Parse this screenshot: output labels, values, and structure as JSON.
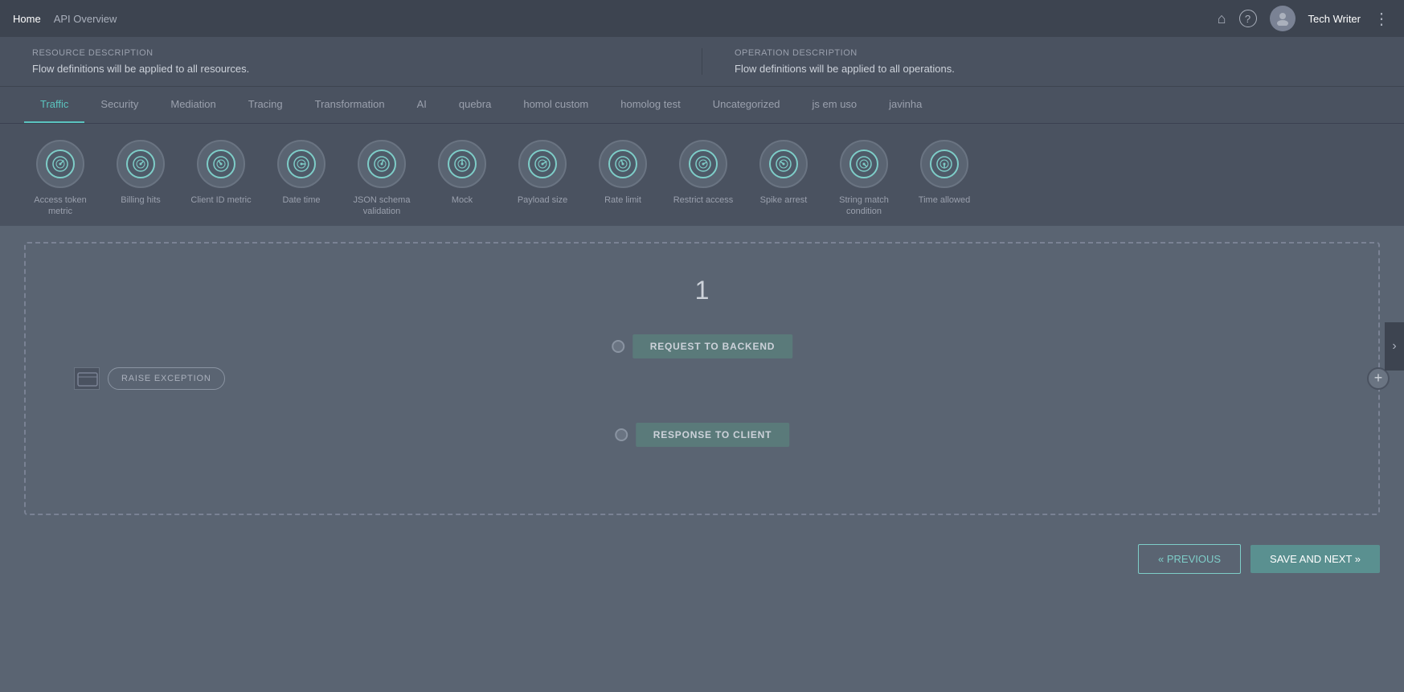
{
  "header": {
    "home_label": "Home",
    "api_overview_label": "API Overview",
    "home_icon": "🏠",
    "help_icon": "?",
    "user_initials": "",
    "username": "Tech Writer",
    "menu_icon": "⋮"
  },
  "descriptions": {
    "resource_label": "Resource description",
    "resource_text": "Flow definitions will be applied to all resources.",
    "operation_label": "Operation description",
    "operation_text": "Flow definitions will be applied to all operations."
  },
  "tabs": [
    {
      "id": "traffic",
      "label": "Traffic",
      "active": true
    },
    {
      "id": "security",
      "label": "Security",
      "active": false
    },
    {
      "id": "mediation",
      "label": "Mediation",
      "active": false
    },
    {
      "id": "tracing",
      "label": "Tracing",
      "active": false
    },
    {
      "id": "transformation",
      "label": "Transformation",
      "active": false
    },
    {
      "id": "ai",
      "label": "AI",
      "active": false
    },
    {
      "id": "quebra",
      "label": "quebra",
      "active": false
    },
    {
      "id": "homol_custom",
      "label": "homol custom",
      "active": false
    },
    {
      "id": "homolog_test",
      "label": "homolog test",
      "active": false
    },
    {
      "id": "uncategorized",
      "label": "Uncategorized",
      "active": false
    },
    {
      "id": "js_em_uso",
      "label": "js em uso",
      "active": false
    },
    {
      "id": "javinha",
      "label": "javinha",
      "active": false
    }
  ],
  "policies": [
    {
      "id": "access_token_metric",
      "label": "Access token metric",
      "icon": "◎"
    },
    {
      "id": "billing_hits",
      "label": "Billing hits",
      "icon": "◎"
    },
    {
      "id": "client_id_metric",
      "label": "Client ID metric",
      "icon": "◎"
    },
    {
      "id": "date_time",
      "label": "Date time",
      "icon": "◎"
    },
    {
      "id": "json_schema_validation",
      "label": "JSON schema validation",
      "icon": "◎"
    },
    {
      "id": "mock",
      "label": "Mock",
      "icon": "◎"
    },
    {
      "id": "payload_size",
      "label": "Payload size",
      "icon": "◎"
    },
    {
      "id": "rate_limit",
      "label": "Rate limit",
      "icon": "◎"
    },
    {
      "id": "restrict_access",
      "label": "Restrict access",
      "icon": "◎"
    },
    {
      "id": "spike_arrest",
      "label": "Spike arrest",
      "icon": "◎"
    },
    {
      "id": "string_match_condition",
      "label": "String match condition",
      "icon": "◎"
    },
    {
      "id": "time_allowed",
      "label": "Time allowed",
      "icon": "◎"
    }
  ],
  "canvas": {
    "number": "1",
    "request_to_backend_label": "REQUEST TO BACKEND",
    "raise_exception_label": "RAISE EXCEPTION",
    "response_to_client_label": "RESPONSE TO CLIENT"
  },
  "footer": {
    "previous_label": "« PREVIOUS",
    "save_next_label": "SAVE AND NEXT »"
  }
}
